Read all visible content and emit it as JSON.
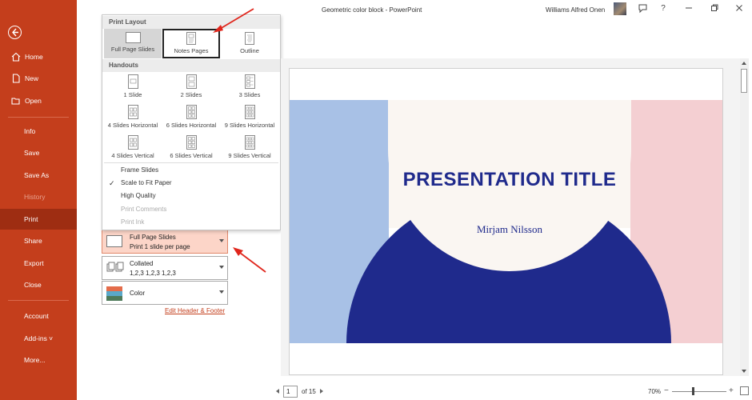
{
  "titlebar": {
    "doc_title": "Geometric color block  -  PowerPoint",
    "user_name": "Williams Alfred Onen",
    "help_label": "?"
  },
  "nav": {
    "items": [
      {
        "label": "Home",
        "icon": "home-icon"
      },
      {
        "label": "New",
        "icon": "new-file-icon"
      },
      {
        "label": "Open",
        "icon": "folder-open-icon"
      },
      {
        "label": "Info"
      },
      {
        "label": "Save"
      },
      {
        "label": "Save As"
      },
      {
        "label": "History",
        "disabled": true
      },
      {
        "label": "Print",
        "selected": true
      },
      {
        "label": "Share"
      },
      {
        "label": "Export"
      },
      {
        "label": "Close"
      },
      {
        "label": "Account"
      },
      {
        "label": "Add-ins ˅"
      },
      {
        "label": "More..."
      }
    ]
  },
  "layout_panel": {
    "print_layout_heading": "Print Layout",
    "print_layout_options": [
      "Full Page Slides",
      "Notes Pages",
      "Outline"
    ],
    "handouts_heading": "Handouts",
    "handout_options": [
      "1 Slide",
      "2 Slides",
      "3 Slides",
      "4 Slides Horizontal",
      "6 Slides Horizontal",
      "9 Slides Horizontal",
      "4 Slides Vertical",
      "6 Slides Vertical",
      "9 Slides Vertical"
    ],
    "frame_slides": "Frame Slides",
    "scale_to_fit": "Scale to Fit Paper",
    "high_quality": "High Quality",
    "print_comments": "Print Comments",
    "print_ink": "Print Ink",
    "check_mark": "✓"
  },
  "settings": {
    "layout": {
      "line1": "Full Page Slides",
      "line2": "Print 1 slide per page"
    },
    "collate": {
      "line1": "Collated",
      "line2": "1,2,3    1,2,3    1,2,3"
    },
    "color": {
      "line1": "Color"
    },
    "header_footer_link": "Edit Header & Footer"
  },
  "preview": {
    "slide_title": "PRESENTATION TITLE",
    "slide_subtitle": "Mirjam Nilsson"
  },
  "pager": {
    "current_page": "1",
    "of_label": "of 15"
  },
  "zoom": {
    "level": "70%",
    "minus": "−",
    "plus": "+"
  },
  "colors": {
    "backstage_red": "#c43e1c",
    "selected_nav": "#9e2d12",
    "slide_navy": "#1f2a8c",
    "slide_blue": "#a8c1e6",
    "slide_pink": "#f4cfd2",
    "slide_cream": "#faf6f2",
    "highlight_orange": "#fcd5c8",
    "annotation_red": "#e0261c"
  }
}
